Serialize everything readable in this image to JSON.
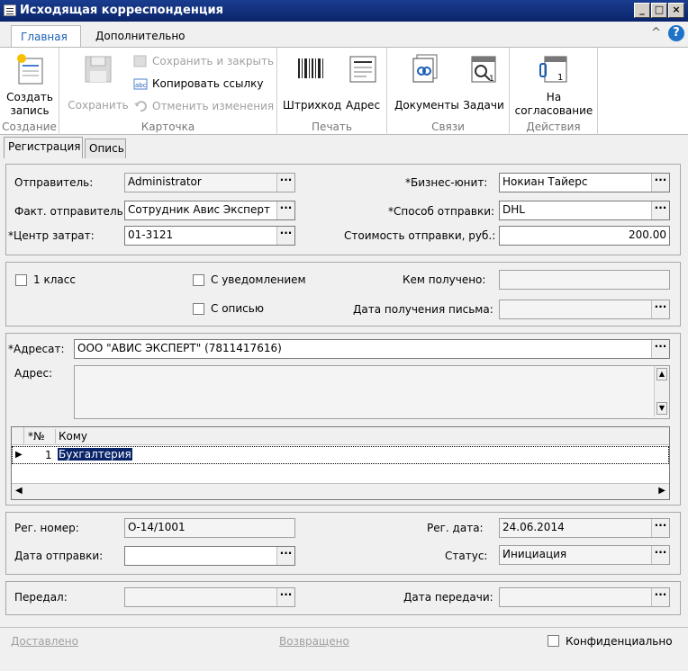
{
  "window": {
    "title": "Исходящая корреспонденция",
    "controls": {
      "minimize": "_",
      "maximize": "□",
      "close": "×"
    }
  },
  "ribbon_tabs": [
    {
      "label": "Главная",
      "active": true
    },
    {
      "label": "Дополнительно",
      "active": false
    }
  ],
  "ribbon": {
    "groups": {
      "create": "Создание",
      "card": "Карточка",
      "print": "Печать",
      "links": "Связи",
      "actions": "Действия"
    },
    "create_record": "Создать запись",
    "save": "Сохранить",
    "save_close": "Сохранить и закрыть",
    "copy_link": "Копировать ссылку",
    "undo_changes": "Отменить изменения",
    "barcode": "Штрихкод",
    "address": "Адрес",
    "documents": "Документы",
    "tasks": "Задачи",
    "to_approval": "На согласование",
    "help": "?",
    "collapse": "^"
  },
  "doc_tabs": [
    {
      "label": "Регистрация",
      "active": true
    },
    {
      "label": "Опись",
      "active": false
    }
  ],
  "reg": {
    "sender_label": "Отправитель:",
    "sender": "Administrator",
    "actual_sender_label": "Факт. отправитель:",
    "actual_sender": "Сотрудник Авис Эксперт",
    "cost_center_label": "*Центр затрат:",
    "cost_center": "01-3121",
    "business_unit_label": "*Бизнес-юнит:",
    "business_unit": "Нокиан Тайерс",
    "ship_method_label": "*Способ отправки:",
    "ship_method": "DHL",
    "ship_cost_label": "Стоимость отправки, руб.:",
    "ship_cost": "200.00"
  },
  "flags": {
    "first_class": "1 класс",
    "with_notice": "С уведомлением",
    "with_inventory": "С описью",
    "received_by_label": "Кем получено:",
    "received_date_label": "Дата получения письма:"
  },
  "addressee": {
    "label": "*Адресат:",
    "value": "ООО \"АВИС ЭКСПЕРТ\" (7811417616)",
    "address_label": "Адрес:",
    "grid": {
      "col_no": "*№",
      "col_to": "Кому",
      "rows": [
        {
          "no": "1",
          "to": "Бухгалтерия"
        }
      ]
    }
  },
  "reginfo": {
    "reg_no_label": "Рег. номер:",
    "reg_no": "О-14/1001",
    "send_date_label": "Дата отправки:",
    "send_date": "",
    "reg_date_label": "Рег. дата:",
    "reg_date": "24.06.2014",
    "status_label": "Статус:",
    "status": "Инициация"
  },
  "transfer": {
    "handed_label": "Передал:",
    "handed": "",
    "handed_date_label": "Дата передачи:",
    "handed_date": ""
  },
  "footer": {
    "delivered": "Доставлено",
    "returned": "Возвращено",
    "confidential": "Конфиденциально"
  },
  "dots": "···"
}
